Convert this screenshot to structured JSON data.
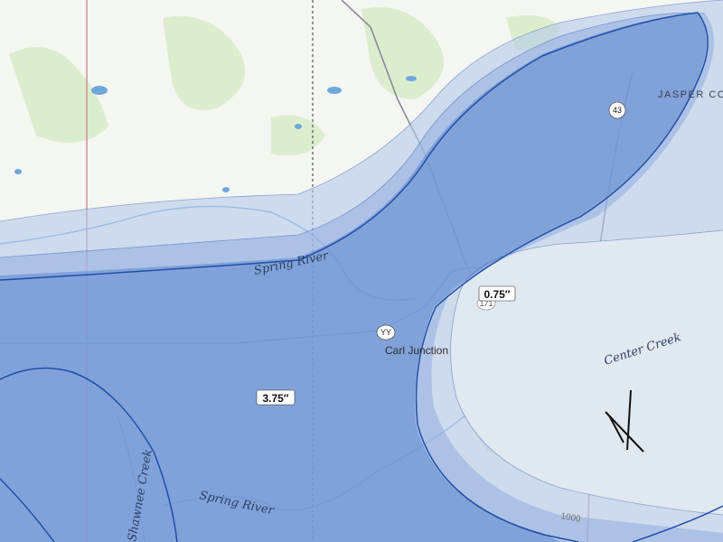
{
  "colors": {
    "base": "#f4f6f2",
    "green": "#d6ebc4",
    "water": "#6fa6dc",
    "urban": "#e6e2dc",
    "band_light": "#b4c9ea",
    "band_mid": "#8fabde",
    "band_dark": "#5f86cf",
    "contour": "#1f4fa8",
    "county_line": "#c98b8b",
    "road": "#8a8a9a",
    "dashed_line": "#555"
  },
  "labels": {
    "county": "JASPER CO",
    "river_upper": "Spring River",
    "river_lower": "Spring River",
    "creek_center": "Center Creek",
    "creek_shawnee": "Shawnee Creek",
    "town": "Carl Junction",
    "shield_yy": "YY",
    "shield_43": "43",
    "road_171": "171",
    "contour_elev": "1000"
  },
  "values": {
    "upper": "0.75″",
    "lower": "3.75″"
  }
}
